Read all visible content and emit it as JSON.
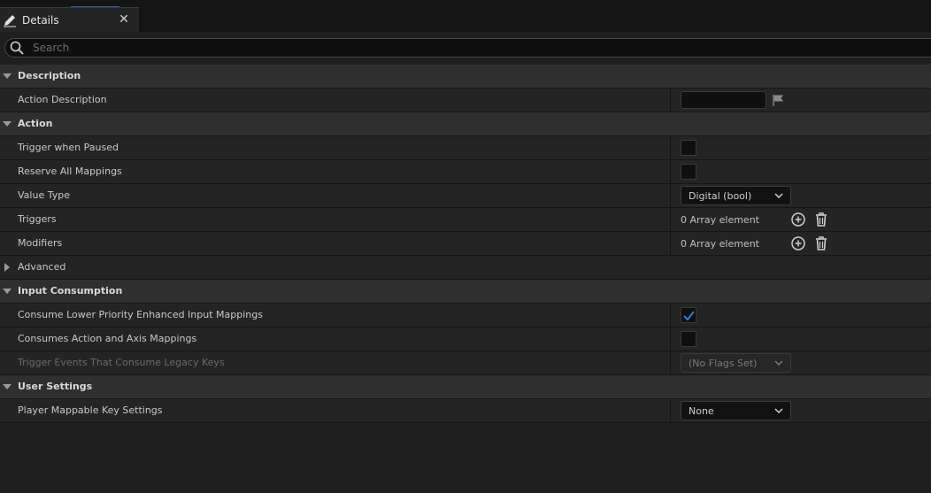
{
  "tab": {
    "title": "Details",
    "icon": "pencil-icon",
    "close_glyph": "✕"
  },
  "search": {
    "placeholder": "Search",
    "value": ""
  },
  "categories": {
    "description": {
      "label": "Description"
    },
    "action": {
      "label": "Action"
    },
    "advanced": {
      "label": "Advanced"
    },
    "input_consumption": {
      "label": "Input Consumption"
    },
    "user_settings": {
      "label": "User Settings"
    }
  },
  "properties": {
    "action_description": {
      "label": "Action Description",
      "value": ""
    },
    "trigger_when_paused": {
      "label": "Trigger when Paused",
      "checked": false
    },
    "reserve_all_mappings": {
      "label": "Reserve All Mappings",
      "checked": false
    },
    "value_type": {
      "label": "Value Type",
      "value": "Digital (bool)"
    },
    "triggers": {
      "label": "Triggers",
      "value": "0 Array element"
    },
    "modifiers": {
      "label": "Modifiers",
      "value": "0 Array element"
    },
    "consume_lower_priority": {
      "label": "Consume Lower Priority Enhanced Input Mappings",
      "checked": true
    },
    "consumes_action_axis": {
      "label": "Consumes Action and Axis Mappings",
      "checked": false
    },
    "trigger_events_legacy": {
      "label": "Trigger Events That Consume Legacy Keys",
      "value": "(No Flags Set)"
    },
    "player_mappable": {
      "label": "Player Mappable Key Settings",
      "value": "None"
    }
  },
  "colors": {
    "accent": "#2f7de1",
    "background": "#1f1f1f",
    "row": "#242424",
    "category": "#2f2f2f"
  }
}
